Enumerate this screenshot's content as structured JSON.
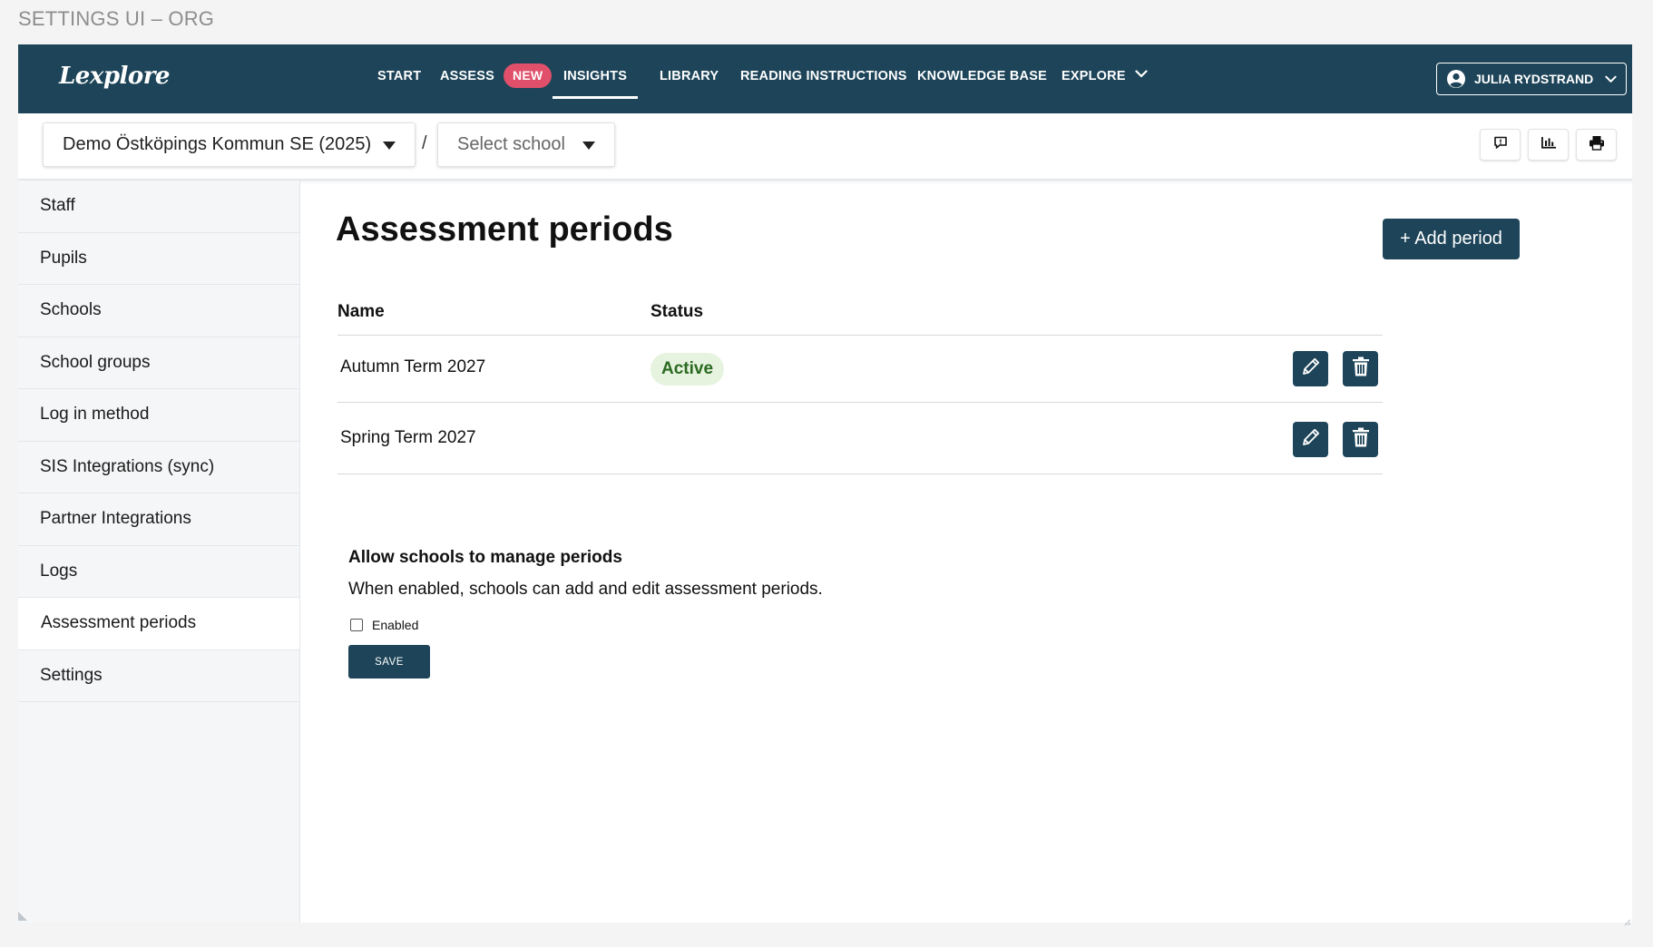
{
  "frame_label": "SETTINGS UI – ORG",
  "header": {
    "logo": "Lexplore",
    "nav": [
      {
        "label": "START"
      },
      {
        "label": "ASSESS",
        "badge": "NEW"
      },
      {
        "label": "INSIGHTS",
        "active": true
      },
      {
        "label": "LIBRARY"
      },
      {
        "label": "READING INSTRUCTIONS"
      },
      {
        "label": "KNOWLEDGE BASE"
      },
      {
        "label": "EXPLORE"
      }
    ],
    "user": {
      "name": "JULIA RYDSTRAND",
      "icon": "user-circle-icon"
    }
  },
  "toolbar": {
    "organization_select": "Demo Östköpings Kommun SE (2025)",
    "separator": "/",
    "school_select_placeholder": "Select school",
    "tools": [
      "feedback-icon",
      "chart-icon",
      "print-icon"
    ]
  },
  "sidebar": {
    "items": [
      {
        "label": "Staff"
      },
      {
        "label": "Pupils"
      },
      {
        "label": "Schools"
      },
      {
        "label": "School groups"
      },
      {
        "label": "Log in method"
      },
      {
        "label": "SIS Integrations (sync)"
      },
      {
        "label": "Partner Integrations"
      },
      {
        "label": "Logs"
      },
      {
        "label": "Assessment periods",
        "active": true
      },
      {
        "label": "Settings"
      }
    ]
  },
  "main": {
    "title": "Assessment periods",
    "add_button": "+ Add period",
    "table": {
      "columns": [
        "Name",
        "Status"
      ],
      "rows": [
        {
          "name": "Autumn Term 2027",
          "status": "Active"
        },
        {
          "name": "Spring Term 2027",
          "status": ""
        }
      ]
    },
    "allow_section": {
      "title": "Allow schools to manage periods",
      "description": "When enabled, schools can add and edit assessment periods.",
      "checkbox_label": "Enabled",
      "checked": false,
      "save_label": "SAVE"
    }
  },
  "colors": {
    "primary": "#1d4458",
    "badge": "#e0506b",
    "active_pill_bg": "#e6f3df",
    "active_pill_text": "#2a6a20",
    "sidebar_bg": "#f4f6f7"
  }
}
